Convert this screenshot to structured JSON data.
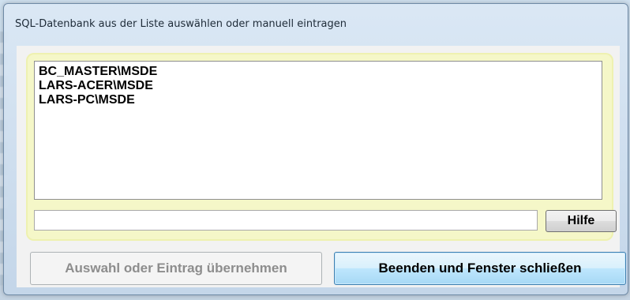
{
  "window": {
    "title": "SQL-Datenbank aus der Liste auswählen oder manuell eintragen"
  },
  "server_list": {
    "items": [
      "BC_MASTER\\MSDE",
      "LARS-ACER\\MSDE",
      "LARS-PC\\MSDE"
    ]
  },
  "entry": {
    "value": "",
    "placeholder": ""
  },
  "buttons": {
    "help_label": "Hilfe",
    "apply_label": "Auswahl oder Eintrag übernehmen",
    "apply_enabled": false,
    "close_label": "Beenden und Fenster schließen"
  },
  "colors": {
    "panel_background": "#f5f7c8",
    "focus_button_border": "#3c7fb1"
  }
}
